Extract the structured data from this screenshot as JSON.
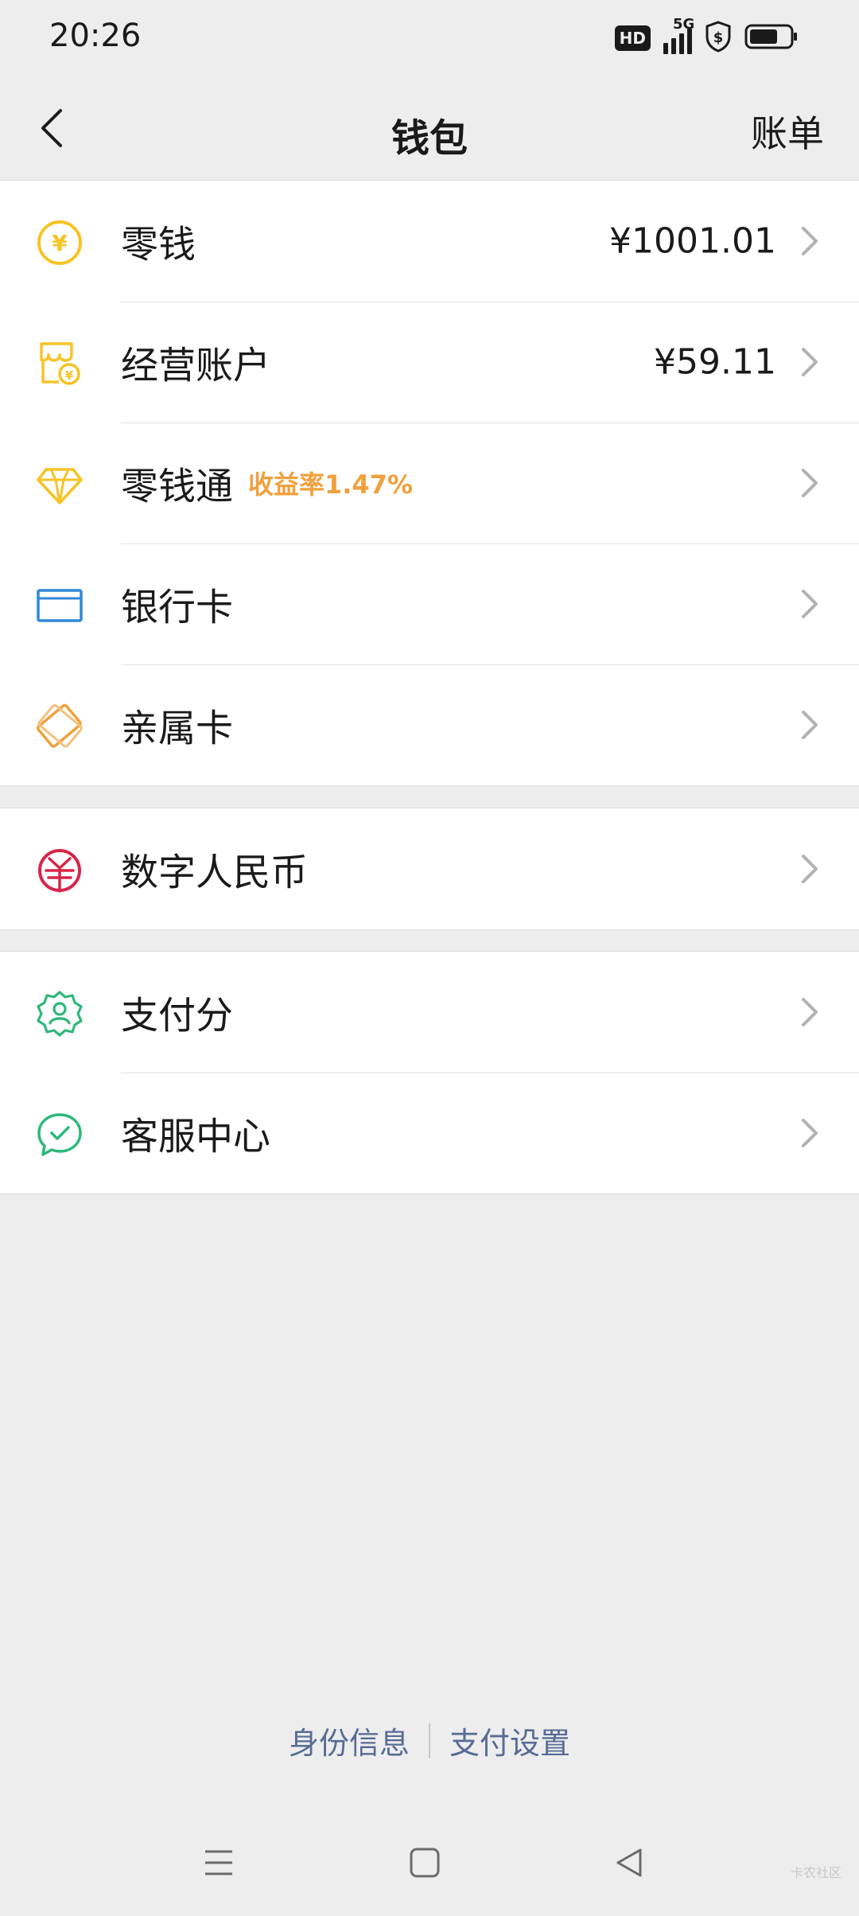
{
  "status_bar": {
    "time": "20:26",
    "hd": "HD",
    "network": "5G"
  },
  "nav": {
    "title": "钱包",
    "action": "账单"
  },
  "groups": [
    {
      "items": [
        {
          "label": "零钱",
          "value": "¥1001.01",
          "icon": "coin-icon",
          "color": "#f7c325"
        },
        {
          "label": "经营账户",
          "value": "¥59.11",
          "icon": "store-icon",
          "color": "#f7c325"
        },
        {
          "label": "零钱通",
          "tag": "收益率1.47%",
          "icon": "diamond-icon",
          "color": "#f7c325"
        },
        {
          "label": "银行卡",
          "icon": "card-icon",
          "color": "#2f88d8"
        },
        {
          "label": "亲属卡",
          "icon": "family-card-icon",
          "color": "#f0a03c"
        }
      ]
    },
    {
      "items": [
        {
          "label": "数字人民币",
          "icon": "digital-rmb-icon",
          "color": "#d8254a"
        }
      ]
    },
    {
      "items": [
        {
          "label": "支付分",
          "icon": "pay-score-icon",
          "color": "#2db87a"
        },
        {
          "label": "客服中心",
          "icon": "customer-service-icon",
          "color": "#2db87a"
        }
      ]
    }
  ],
  "footer": {
    "identity": "身份信息",
    "pay_settings": "支付设置"
  },
  "watermark": "卡农社区",
  "colors": {
    "background": "#ededed",
    "link": "#576b95",
    "tag": "#f0a03c"
  }
}
